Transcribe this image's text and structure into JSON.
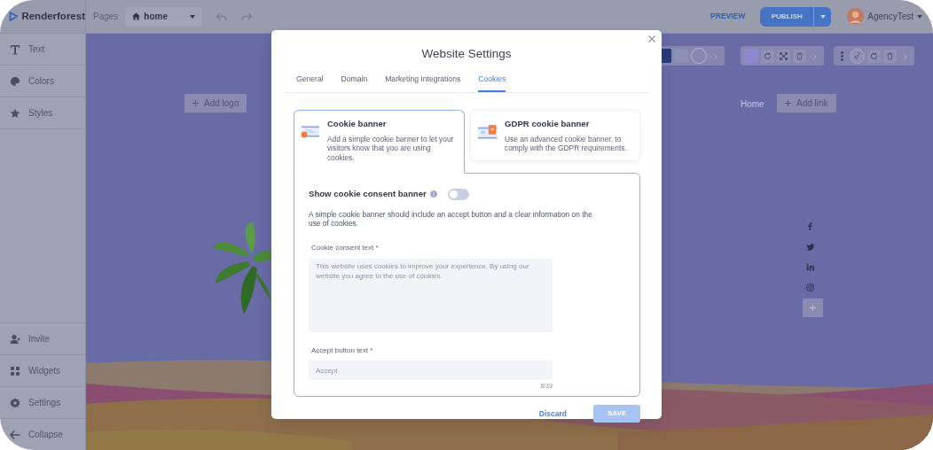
{
  "topbar": {
    "logo": "Renderforest",
    "pages_label": "Pages",
    "page": "home",
    "preview": "PREVIEW",
    "publish": "PUBLISH",
    "user": "AgencyTest"
  },
  "sidebar": {
    "top_items": [
      {
        "label": "Text",
        "kind": "text"
      },
      {
        "label": "Colors",
        "kind": "palette"
      },
      {
        "label": "Styles",
        "kind": "star"
      }
    ],
    "bottom_items": [
      {
        "label": "Invite",
        "kind": "invite"
      },
      {
        "label": "Widgets",
        "kind": "widgets"
      },
      {
        "label": "Settings",
        "kind": "settings"
      },
      {
        "label": "Collapse",
        "kind": "collapse"
      }
    ]
  },
  "canvas": {
    "add_logo": "Add logo",
    "nav_link": "Home",
    "add_link": "Add link"
  },
  "modal": {
    "title": "Website Settings",
    "tabs": [
      {
        "label": "General",
        "selected": false
      },
      {
        "label": "Domain",
        "selected": false
      },
      {
        "label": "Marketing Integrations",
        "selected": false
      },
      {
        "label": "Cookies",
        "selected": true
      }
    ],
    "options": [
      {
        "title": "Cookie banner",
        "description": "Add a simple cookie banner to let your visitors know that you are using cookies.",
        "kind": "simple",
        "selected": true
      },
      {
        "title": "GDPR cookie banner",
        "description": "Use an advanced cookie banner, to comply with the GDPR requirements.",
        "kind": "gdpr",
        "selected": false
      }
    ],
    "toggle": {
      "label": "Show cookie consent banner",
      "on": false
    },
    "note": "A simple cookie banner should include an accept button and a clear information on the use of cookies.",
    "consent": {
      "label": "Cookie consent text *",
      "placeholder": "This website uses cookies to improve your experience. By using our website you agree to the use of cookies."
    },
    "accept": {
      "label": "Accept button text *",
      "placeholder": "Accept",
      "counter": "6/19"
    },
    "discard": "Discard",
    "save": {
      "label": "SAVE",
      "disabled": true
    }
  }
}
